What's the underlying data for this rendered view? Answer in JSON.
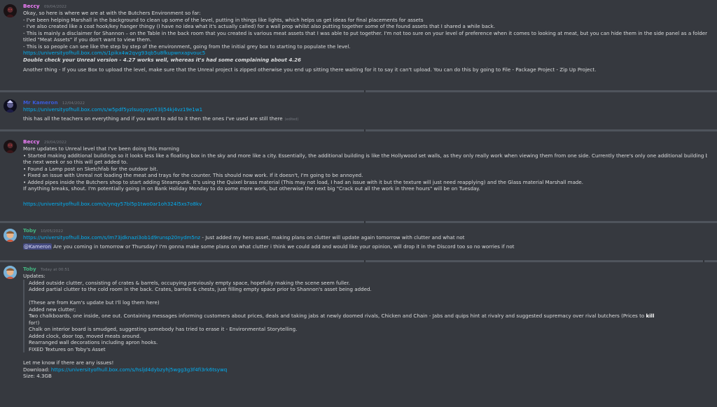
{
  "messages": [
    {
      "author": "Beccy",
      "author_color": "#f47fff",
      "time": "09/04/2022",
      "lines": [
        "Okay, so here is where we are at with the Butchers Environment so far:",
        "-   I've been helping Marshall in the background to clean up some of the level, putting in things like lights, which helps us get ideas for final placements for assets",
        "-   I've also created like a coat hook/key hanger thingy (I have no idea what it's actually called) for a wall prop whilst also putting together some of the found assets that I shared a while back.",
        "-   This is mainly a disclaimer for Shannon – on the Table in the back room that you created is various meat assets that I was able to put together. I'm not too sure on your level of preference when it comes to looking at meat, but you can hide them in the side panel as a folder",
        "titled \"Meat Assets\" if you don't want to view them.",
        "-   This is so people can see like the step by step of the environment, going from the initial grey box to starting to populate the level."
      ],
      "link": "https://universityofhull.box.com/s/1pikx4w2qvg93qb5u8fkupwnxapvouc5",
      "bold_note": "Double check your Unreal version - 4.27 works well, whereas it's had some complaining about 4.26",
      "footer": "Another thing - If you use Box to upload the level, make sure that the Unreal project is zipped otherwise you end up sitting there waiting for it to say it can't upload. You can do this by going to File - Package Project - Zip Up Project."
    },
    {
      "author": "Mr Kameron",
      "author_color": "#3b5bdb",
      "time": "12/04/2022",
      "link": "https://universityofhull.box.com/s/w5pdf5yzlsuqyoyn53lj54kj4vz19e1w1",
      "text": "this has all the teachers on everything and if you want to add to it then the ones I've used are still there",
      "edited": "(edited)"
    },
    {
      "author": "Beccy",
      "author_color": "#f47fff",
      "time": "29/04/2022",
      "lines": [
        "More updates to Unreal level that I've been doing this morning",
        "•   Started making additional buildings so it looks less like a floating box in the sky and more like a city. Essentially, the additional building is like the Hollywood set walls, as they only really work when viewing them from one side. Currently there's only one additional building but across",
        "the next week or so this will get added to.",
        "•   Found a Lamp post on Sketchfab for the outdoor bit.",
        "•   Fixed an issue with Unreal not loading the meat and trays for the counter. This should now work. If it doesn't, I'm going to be annoyed.",
        "•   Added pipes inside the Butchers shop to start adding Steampunk. It's using the Quixel brass material (This may not load, I had an issue with it but the texture will just need reapplying) and the Glass material Marshall made.",
        "If anything breaks, shout. I'm potentially going in on Bank Holiday Monday to do some more work, but otherwise the next big \"Crack out all the work in three hours\" will be on Tuesday."
      ],
      "link": "https://universityofhull.box.com/s/ynqy57bl5p1two0ar1oh324l5xs7o8kv"
    },
    {
      "author": "Toby",
      "author_color": "#43b581",
      "time": "10/05/2022",
      "link": "https://universityofhull.box.com/s/lm73jdknazi3ob1d9runsp20nydm5nz",
      "link_suffix": " - Just added my hero asset, making plans on clutter will update again tomorrow with clutter and what not",
      "mention": "@Kameron",
      "mention_text": " Are you coming in tomorrow or Thursday? I'm gonna make some plans on what clutter i think we could add and would like your opinion, will drop it in the Discord too so no worries if not"
    },
    {
      "author": "Toby",
      "author_color": "#43b581",
      "time": "Today at 00:51",
      "heading": "Updates:",
      "quote_lines": [
        "Added outside clutter, consisting of crates & barrels, occupying previously empty space, hopefully making the scene seem fuller.",
        "Added partial clutter to the cold room in the back. Crates, barrels & chests, just filling empty space prior to Shannon's asset being added.",
        "",
        "(These are from Kam's update but I'll log them here)",
        "Added new clutter;"
      ],
      "chalk_line": "Two chalkboards, one inside, one out. Containing messages informing customers about prices, deals and taking jabs at newly doomed rivals, Chicken and Chain - Jabs and quips hint at rivalry and suggested supremacy over rival butchers (Prices to ",
      "chalk_bold": "kill",
      "chalk_end": "for!)",
      "quote_lines2": [
        "Chalk on interior board is smudged, suggesting somebody has tried to erase it - Environmental Storytelling.",
        "Added clock, door top, moved meats around.",
        "Rearranged wall decorations including apron hooks.",
        "FIXED Textures on Toby's Asset"
      ],
      "closing": "Let me know if there are any issues!",
      "download_label": "Download: ",
      "download_link": "https://universityofhull.box.com/s/hsljd4dybzyhj5wgg3g3f4fi3rk6tsywq",
      "size": "Size: 4.3GB"
    }
  ]
}
